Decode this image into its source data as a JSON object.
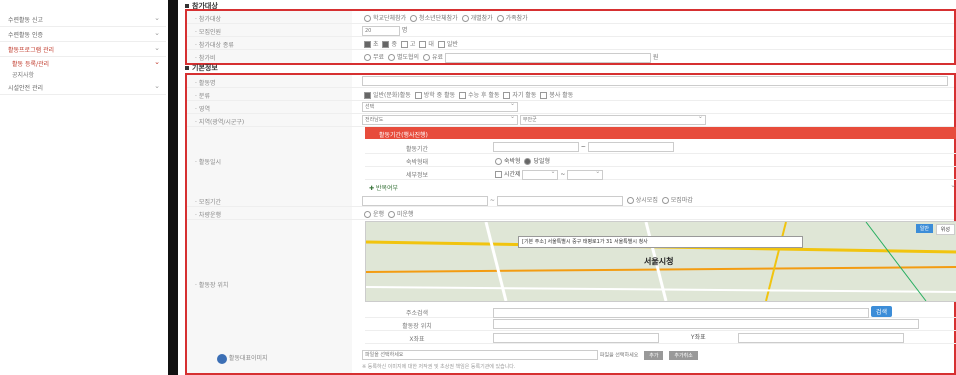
{
  "sidebar": {
    "items": [
      {
        "label": "수련활동 신고"
      },
      {
        "label": "수련활동 인증"
      },
      {
        "label": "활동프로그램 관리"
      },
      {
        "label": "활동 등록/관리"
      },
      {
        "label": "공지사항"
      },
      {
        "label": "시설안전 관리"
      }
    ]
  },
  "section_participation": {
    "title": "참가대상",
    "rows": {
      "target_label": "참가대상",
      "target_options": [
        "학교단체참가",
        "청소년단체참가",
        "개별참가",
        "가족참가"
      ],
      "recruit_label": "모집인원",
      "recruit_value": "20",
      "recruit_unit": "명",
      "type_label": "참가대상 종류",
      "type_options": [
        "초",
        "중",
        "고",
        "대",
        "일반"
      ],
      "fee_label": "참가비",
      "fee_options": [
        "무료",
        "별도협의",
        "유료"
      ],
      "fee_unit": "원"
    }
  },
  "section_basic": {
    "title": "기본정보",
    "name_label": "활동명",
    "category_label": "분류",
    "category_options": [
      "일반(문화)활동",
      "방학 중 활동",
      "수능 후 활동",
      "자기 활동",
      "봉사 활동"
    ],
    "field_label": "영역",
    "field_value": "선택",
    "region_label": "지역(광역/시군구)",
    "region_value1": "전라남도",
    "region_value2": "무안군",
    "period_panel_title": "활동기간(행사진행)",
    "schedule_label": "활동일시",
    "period_label": "활동기간",
    "stay_label": "숙박형태",
    "stay_options": [
      "숙박형",
      "당일형"
    ],
    "detail_label": "세부정보",
    "detail_option": "시간제",
    "repeat_label": "반복여부",
    "recruit_period_label": "모집기간",
    "recruit_period_options": [
      "상시모집",
      "모집마감"
    ],
    "vehicle_label": "차량운행",
    "vehicle_options": [
      "운행",
      "미운행"
    ],
    "location_label": "활동장 위치",
    "map_tooltip": "[기본 주소] 서울특별시 중구 태평로1가 31 서울특별시 청사",
    "map_city_hall": "서울시청",
    "map_tabs": [
      "일반",
      "위성"
    ],
    "address_search_label": "주소검색",
    "address_search_button": "검색",
    "location_field_label": "활동장 위치",
    "x_label": "X좌표",
    "y_label": "Y좌표",
    "image_label": "활동대표이미지",
    "image_placeholder": "파일을 선택하세요",
    "image_status": "파일을 선택하세요",
    "add_button": "추가",
    "delete_button": "추가취소",
    "note": "※ 등록하신 이미지에 대한 저작권 및 초상권 책임은 등록기관에 있습니다."
  }
}
